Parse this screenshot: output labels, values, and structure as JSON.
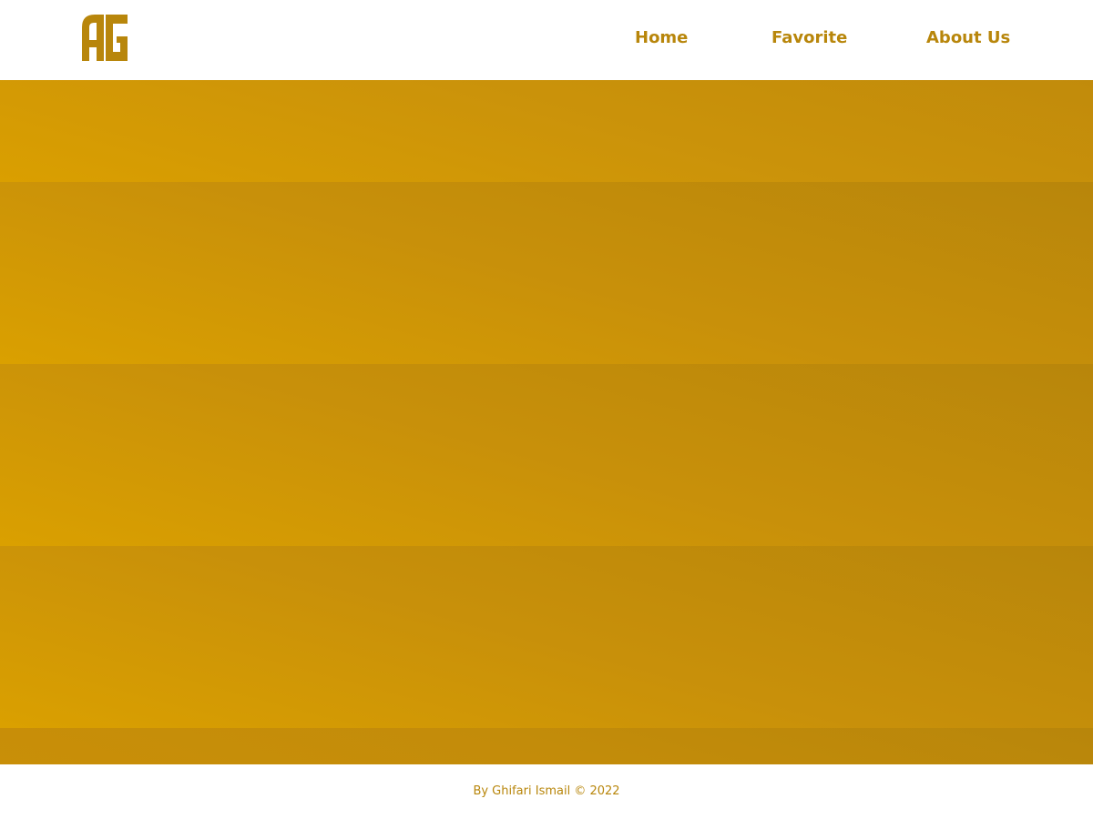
{
  "brand": {
    "logo_text": "AG",
    "accent_color": "#B8860B"
  },
  "nav": {
    "items": [
      {
        "label": "Home"
      },
      {
        "label": "Favorite"
      },
      {
        "label": "About Us"
      }
    ]
  },
  "footer": {
    "text": "By Ghifari Ismail © 2022"
  },
  "colors": {
    "gradient_start": "#DAA000",
    "gradient_end": "#B8860B",
    "background": "#FFFFFF"
  }
}
